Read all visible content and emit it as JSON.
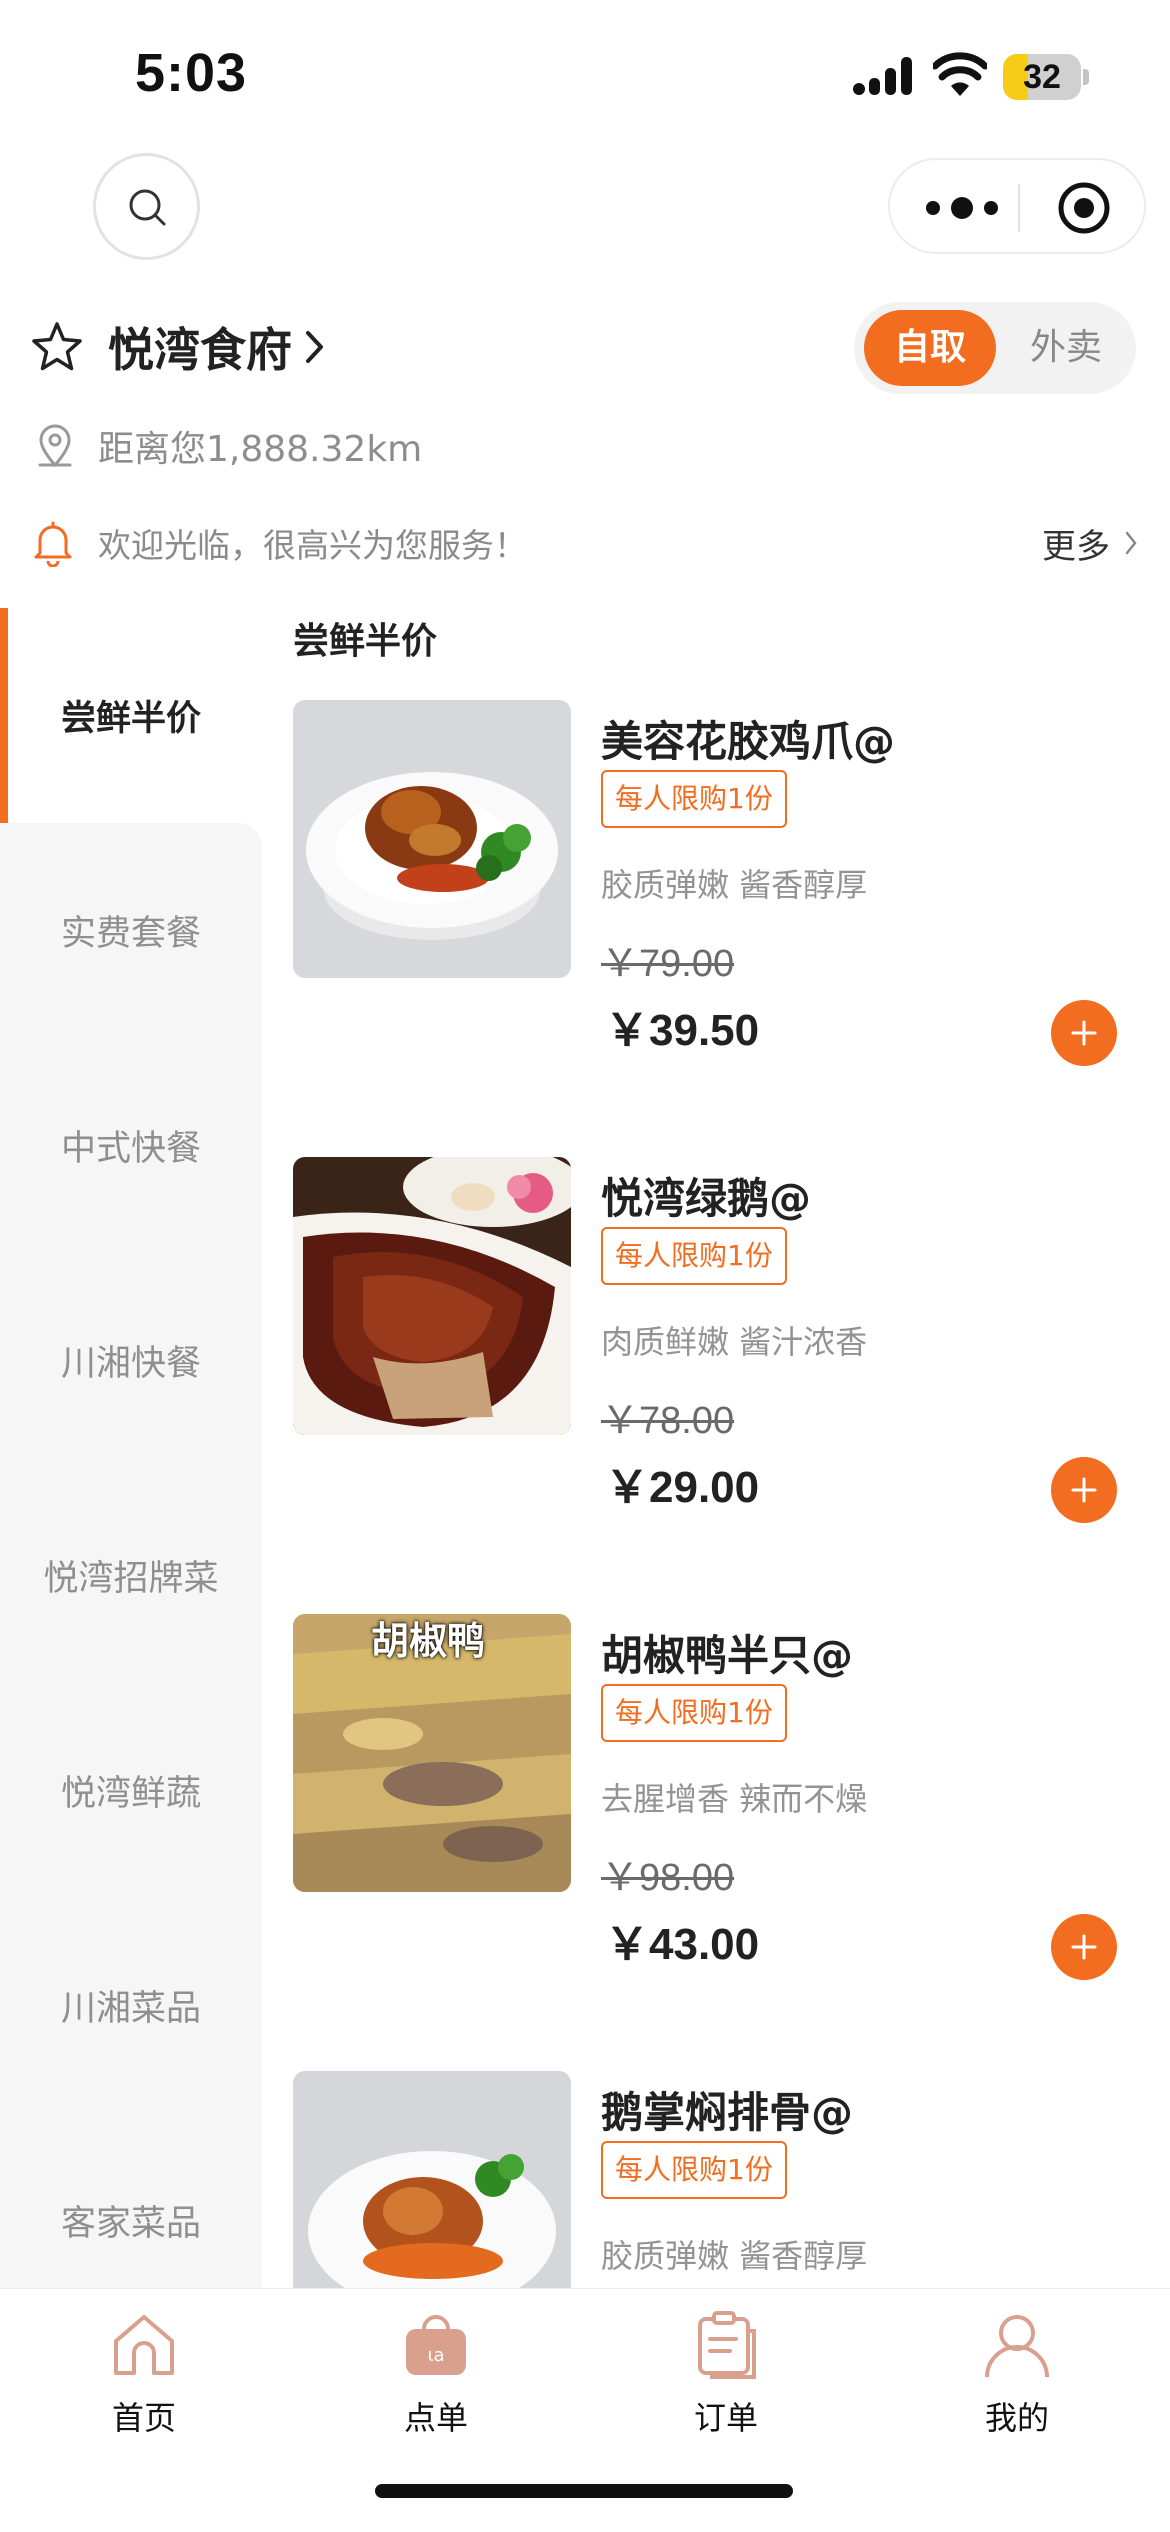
{
  "status_bar": {
    "time": "5:03",
    "battery": "32",
    "battery_level": 0.32
  },
  "store": {
    "name": "悦湾食府",
    "distance": "距离您1,888.32km"
  },
  "mode_toggle": {
    "active": "自取",
    "inactive": "外卖"
  },
  "notice": {
    "text": "欢迎光临，很高兴为您服务！",
    "more": "更多"
  },
  "sidebar": {
    "items": [
      {
        "label": "尝鲜半价"
      },
      {
        "label": "实费套餐"
      },
      {
        "label": "中式快餐"
      },
      {
        "label": "川湘快餐"
      },
      {
        "label": "悦湾招牌菜"
      },
      {
        "label": "悦湾鲜蔬"
      },
      {
        "label": "川湘菜品"
      },
      {
        "label": "客家菜品"
      }
    ]
  },
  "section": {
    "title": "尝鲜半价"
  },
  "products": [
    {
      "name": "美容花胶鸡爪@",
      "limit": "每人限购1份",
      "desc": "胶质弹嫩 酱香醇厚",
      "old_price": "￥79.00",
      "price": "￥39.50"
    },
    {
      "name": "悦湾绿鹅@",
      "limit": "每人限购1份",
      "desc": "肉质鲜嫩 酱汁浓香",
      "old_price": "￥78.00",
      "price": "￥29.00"
    },
    {
      "name": "胡椒鸭半只@",
      "limit": "每人限购1份",
      "desc": "去腥增香 辣而不燥",
      "old_price": "￥98.00",
      "price": "￥43.00",
      "image_caption": "胡椒鸭"
    },
    {
      "name": "鹅掌焖排骨@",
      "limit": "每人限购1份",
      "desc": "胶质弹嫩 酱香醇厚"
    }
  ],
  "tabbar": {
    "items": [
      {
        "label": "首页",
        "icon": "home-icon"
      },
      {
        "label": "点单",
        "icon": "shopping-bag-icon"
      },
      {
        "label": "订单",
        "icon": "order-list-icon"
      },
      {
        "label": "我的",
        "icon": "user-icon"
      }
    ]
  },
  "colors": {
    "accent": "#f26d1f",
    "tab_icon": "#d9a08e"
  }
}
